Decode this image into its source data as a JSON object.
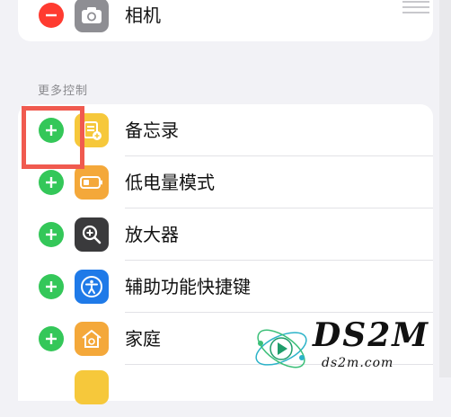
{
  "top_item": {
    "label": "相机",
    "icon": "camera-icon"
  },
  "section": {
    "header": "更多控制"
  },
  "items": [
    {
      "label": "备忘录",
      "icon": "notes-icon",
      "icon_color": "#f6c83b"
    },
    {
      "label": "低电量模式",
      "icon": "battery-icon",
      "icon_color": "#f4a83a"
    },
    {
      "label": "放大器",
      "icon": "magnifier-icon",
      "icon_color": "#3a3a3c"
    },
    {
      "label": "辅助功能快捷键",
      "icon": "accessibility-icon",
      "icon_color": "#1f7ae8"
    },
    {
      "label": "家庭",
      "icon": "home-icon",
      "icon_color": "#f4a83a"
    }
  ],
  "watermark": {
    "title": "DS2M",
    "subtitle": "ds2m.com"
  },
  "colors": {
    "add": "#34c759",
    "remove": "#ff3b30",
    "highlight": "#f05a4f"
  }
}
